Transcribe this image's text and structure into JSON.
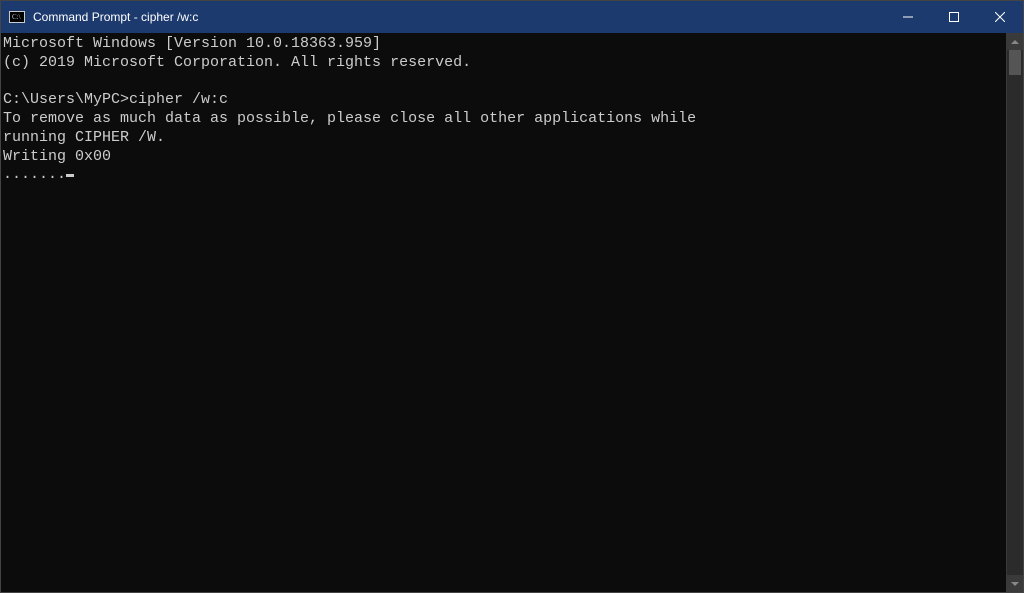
{
  "window": {
    "title": "Command Prompt - cipher  /w:c"
  },
  "terminal": {
    "line1": "Microsoft Windows [Version 10.0.18363.959]",
    "line2": "(c) 2019 Microsoft Corporation. All rights reserved.",
    "blank1": "",
    "prompt": "C:\\Users\\MyPC>",
    "command": "cipher /w:c",
    "msg1": "To remove as much data as possible, please close all other applications while",
    "msg2": "running CIPHER /W.",
    "status": "Writing 0x00",
    "progress": "......."
  }
}
